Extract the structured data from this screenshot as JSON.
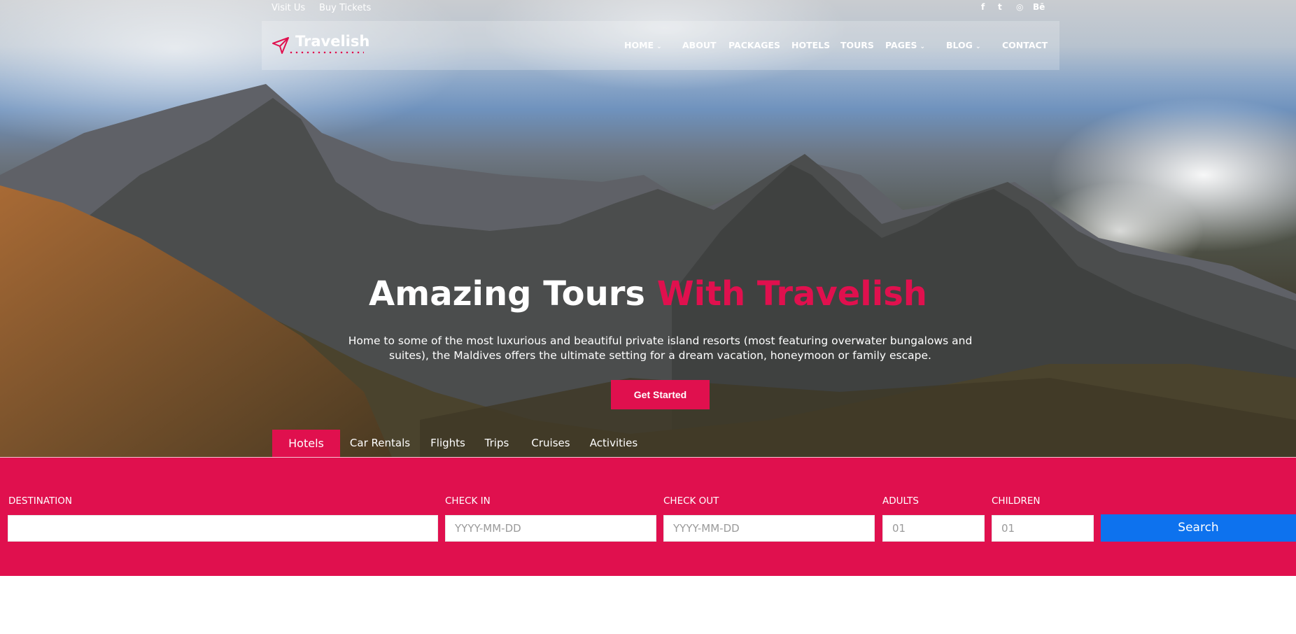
{
  "topbar": {
    "links": [
      "Visit Us",
      "Buy Tickets"
    ],
    "social": [
      {
        "icon": "facebook-icon",
        "glyph": "f"
      },
      {
        "icon": "twitter-icon",
        "glyph": "t"
      },
      {
        "icon": "dribbble-icon",
        "glyph": "◎"
      },
      {
        "icon": "behance-icon",
        "glyph": "Bē"
      }
    ]
  },
  "brand": {
    "name": "Travelish",
    "icon": "paper-plane-icon",
    "accent_color": "#e0104e"
  },
  "nav": {
    "home": "HOME",
    "about": "ABOUT",
    "packages": "PACKAGES",
    "hotels": "HOTELS",
    "tours": "TOURS",
    "pages": "PAGES",
    "blog": "BLOG",
    "contact": "CONTACT"
  },
  "hero": {
    "title_main": "Amazing Tours",
    "title_accent": "With Travelish",
    "subtitle": "Home to some of the most luxurious and beautiful private island resorts (most featuring overwater bungalows and suites), the Maldives offers the ultimate setting for a dream vacation, honeymoon or family escape.",
    "cta": "Get Started"
  },
  "tabs": [
    "Hotels",
    "Car Rentals",
    "Flights",
    "Trips",
    "Cruises",
    "Activities"
  ],
  "active_tab": "Hotels",
  "search": {
    "destination_label": "DESTINATION",
    "destination_value": "",
    "checkin_label": "CHECK IN",
    "checkin_placeholder": "YYYY-MM-DD",
    "checkout_label": "CHECK OUT",
    "checkout_placeholder": "YYYY-MM-DD",
    "adults_label": "ADULTS",
    "adults_value": "01",
    "children_label": "CHILDREN",
    "children_value": "01",
    "button": "Search",
    "button_color": "#0d72ee"
  }
}
